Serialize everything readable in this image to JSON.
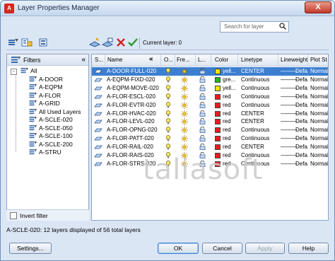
{
  "window": {
    "title": "Layer Properties Manager",
    "close_label": "X",
    "app_icon_label": "A"
  },
  "search": {
    "placeholder": "Search for layer"
  },
  "toolbar": {
    "current_layer_label": "Current layer: 0"
  },
  "filters": {
    "header": "Filters",
    "collapse_label": "«",
    "tree": [
      {
        "label": "All",
        "level": 0
      },
      {
        "label": "A-DOOR",
        "level": 1
      },
      {
        "label": "A-EQPM",
        "level": 1
      },
      {
        "label": "A-FLOR",
        "level": 1
      },
      {
        "label": "A-GRID",
        "level": 1
      },
      {
        "label": "All Used Layers",
        "level": 1
      },
      {
        "label": "A-SCLE-020",
        "level": 1
      },
      {
        "label": "A-SCLE-050",
        "level": 1
      },
      {
        "label": "A-SCLE-100",
        "level": 1
      },
      {
        "label": "A-SCLE-200",
        "level": 1
      },
      {
        "label": "A-STRU",
        "level": 1
      }
    ],
    "invert_label": "Invert filter"
  },
  "grid": {
    "collapse_label": "«",
    "columns": [
      "S...",
      "Name",
      "O...",
      "Fre...",
      "L...",
      "Color",
      "Linetype",
      "Lineweight",
      "Plot St"
    ],
    "rows": [
      {
        "name": "A-DOOR-FULL-020",
        "color_name": "yell...",
        "color_hex": "#f5e400",
        "linetype": "CENTER",
        "lineweight": "Defa...",
        "plot": "Normal",
        "selected": true
      },
      {
        "name": "A-EQPM-FIXD-020",
        "color_name": "gre...",
        "color_hex": "#23b823",
        "linetype": "Continuous",
        "lineweight": "Defa...",
        "plot": "Normal",
        "selected": false
      },
      {
        "name": "A-EQPM-MOVE-020",
        "color_name": "yell...",
        "color_hex": "#f5e400",
        "linetype": "Continuous",
        "lineweight": "Defa...",
        "plot": "Normal",
        "selected": false
      },
      {
        "name": "A-FLOR-ESCL-020",
        "color_name": "red",
        "color_hex": "#e81d1d",
        "linetype": "Continuous",
        "lineweight": "Defa...",
        "plot": "Normal",
        "selected": false
      },
      {
        "name": "A-FLOR-EVTR-020",
        "color_name": "red",
        "color_hex": "#e81d1d",
        "linetype": "Continuous",
        "lineweight": "Defa...",
        "plot": "Normal",
        "selected": false
      },
      {
        "name": "A-FLOR-HVAC-020",
        "color_name": "red",
        "color_hex": "#e81d1d",
        "linetype": "CENTER",
        "lineweight": "Defa...",
        "plot": "Normal",
        "selected": false
      },
      {
        "name": "A-FLOR-LEVL-020",
        "color_name": "red",
        "color_hex": "#e81d1d",
        "linetype": "CENTER",
        "lineweight": "Defa...",
        "plot": "Normal",
        "selected": false
      },
      {
        "name": "A-FLOR-OPNG-020",
        "color_name": "red",
        "color_hex": "#e81d1d",
        "linetype": "Continuous",
        "lineweight": "Defa...",
        "plot": "Normal",
        "selected": false
      },
      {
        "name": "A-FLOR-PATT-020",
        "color_name": "red",
        "color_hex": "#e81d1d",
        "linetype": "Continuous",
        "lineweight": "Defa...",
        "plot": "Normal",
        "selected": false
      },
      {
        "name": "A-FLOR-RAIL-020",
        "color_name": "red",
        "color_hex": "#e81d1d",
        "linetype": "CENTER",
        "lineweight": "Defa...",
        "plot": "Normal",
        "selected": false
      },
      {
        "name": "A-FLOR-RAIS-020",
        "color_name": "red",
        "color_hex": "#e81d1d",
        "linetype": "Continuous",
        "lineweight": "Defa...",
        "plot": "Normal",
        "selected": false
      },
      {
        "name": "A-FLOR-STRS-020",
        "color_name": "red",
        "color_hex": "#e81d1d",
        "linetype": "Continuous",
        "lineweight": "Defa...",
        "plot": "Normal",
        "selected": false
      }
    ]
  },
  "watermark": "taliasoft",
  "status": {
    "text": "A-SCLE-020: 12 layers displayed of 56 total layers"
  },
  "buttons": {
    "settings": "Settings...",
    "ok": "OK",
    "cancel": "Cancel",
    "apply": "Apply",
    "help": "Help"
  },
  "colors": {
    "selection": "#3c7fd0",
    "window_bg": "#dbe6f4",
    "border": "#8ea4c3"
  }
}
